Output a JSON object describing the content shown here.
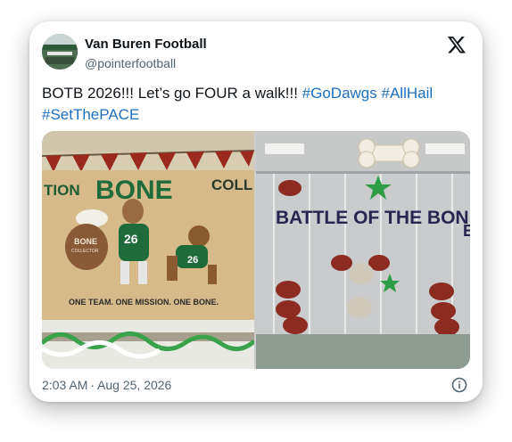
{
  "account": {
    "display_name": "Van Buren Football",
    "handle": "@pointerfootball"
  },
  "post": {
    "text_main": "BOTB 2026!!! Let’s go FOUR a walk!!!",
    "hashtags": [
      "#GoDawgs",
      "#AllHail",
      "#SetThePACE"
    ],
    "timestamp_time": "2:03 AM",
    "separator": "·",
    "timestamp_date": "Aug 25, 2026"
  },
  "media": {
    "photo_left": {
      "banner_left": "TION",
      "banner_center": "BONE",
      "banner_right": "COLL",
      "sack_label_line1": "BONE",
      "sack_label_line2": "COLLECTOR",
      "jersey_number_1": "26",
      "jersey_number_2": "26",
      "slogan": "ONE TEAM. ONE MISSION. ONE BONE."
    },
    "photo_right": {
      "balloon_text_line1": "BATTLE OF THE BON",
      "balloon_text_line2": "E"
    }
  },
  "colors": {
    "hashtag": "#1d6fc0",
    "primary_text": "#0f1419",
    "secondary_text": "#536471",
    "team_green": "#1f6b3a"
  },
  "icons": [
    "x-logo-icon",
    "info-icon"
  ]
}
